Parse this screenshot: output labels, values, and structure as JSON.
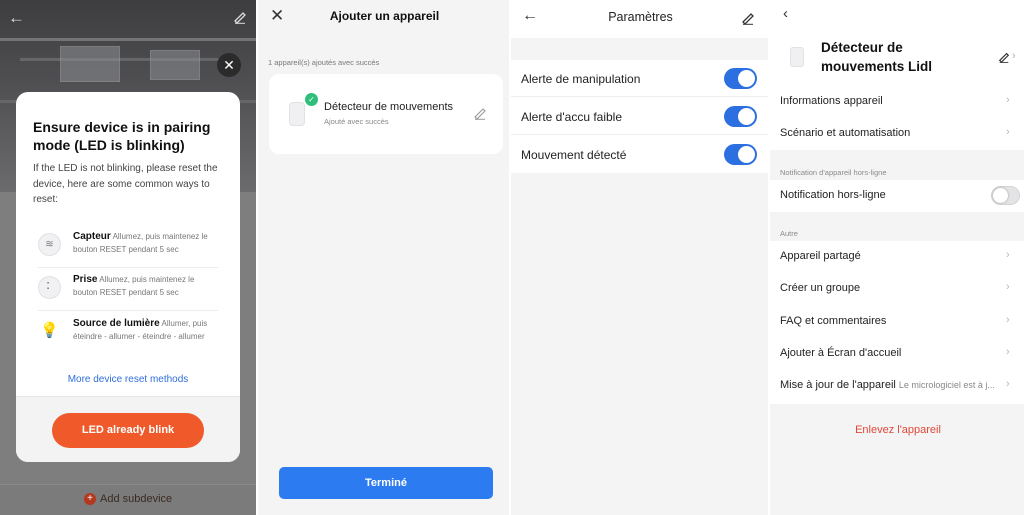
{
  "colors": {
    "accent_blue": "#2c6fe0",
    "button_blue": "#2c7bf0",
    "orange": "#f05a2a",
    "link_blue": "#2f6fdc",
    "danger_red": "#e0483a",
    "success_green": "#2fbf7a"
  },
  "panel1": {
    "back_icon": "arrow-left-icon",
    "modal": {
      "title": "Ensure device is in pairing mode (LED is blinking)",
      "description": "If the LED is not blinking, please reset the device, here are some common ways to reset:",
      "items": [
        {
          "icon": "sensor-icon",
          "name": "Capteur",
          "text": "Allumez, puis maintenez le bouton RESET pendant 5 sec"
        },
        {
          "icon": "plug-icon",
          "name": "Prise",
          "text": "Allumez, puis maintenez le bouton RESET pendant 5 sec"
        },
        {
          "icon": "bulb-icon",
          "name": "Source de lumière",
          "text": "Allumer, puis éteindre - allumer - éteindre - allumer"
        }
      ],
      "more_link": "More device reset methods",
      "primary_button": "LED already blink"
    },
    "add_subdevice": "Add subdevice"
  },
  "panel2": {
    "title": "Ajouter un appareil",
    "success_count": "1 appareil(s) ajoutés avec succès",
    "device_name": "Détecteur de mouvements",
    "device_status": "Ajouté avec succès",
    "done_button": "Terminé"
  },
  "panel3": {
    "title": "Paramètres",
    "settings": [
      {
        "label": "Alerte de manipulation",
        "enabled": true
      },
      {
        "label": "Alerte d'accu faible",
        "enabled": true
      },
      {
        "label": "Mouvement détecté",
        "enabled": true
      }
    ]
  },
  "panel4": {
    "device_title": "Détecteur de mouvements Lidl",
    "menu_main": [
      {
        "label": "Informations appareil"
      },
      {
        "label": "Scénario et automatisation"
      }
    ],
    "offline_section_header": "Notification d'appareil hors-ligne",
    "offline_notification": {
      "label": "Notification hors-ligne",
      "enabled": false
    },
    "other_section_header": "Autre",
    "menu_other": [
      {
        "label": "Appareil partagé"
      },
      {
        "label": "Créer un groupe"
      },
      {
        "label": "FAQ et commentaires"
      },
      {
        "label": "Ajouter à Écran d'accueil"
      },
      {
        "label": "Mise à jour de l'appareil",
        "sub": "Le micrologiciel est à j..."
      }
    ],
    "remove_device": "Enlevez l'appareil"
  }
}
